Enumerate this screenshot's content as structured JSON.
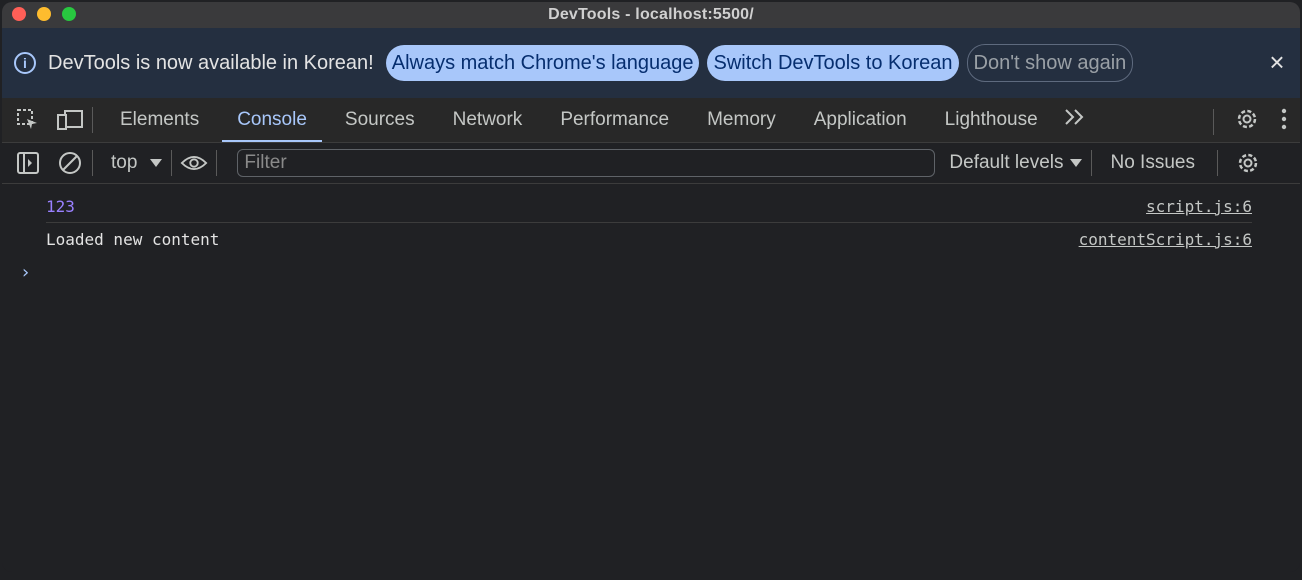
{
  "window": {
    "title": "DevTools - localhost:5500/"
  },
  "infobar": {
    "message": "DevTools is now available in Korean!",
    "buttons": [
      {
        "label": "Always match Chrome's language"
      },
      {
        "label": "Switch DevTools to Korean"
      },
      {
        "label": "Don't show again"
      }
    ],
    "close_icon": "close-icon"
  },
  "tabs": [
    {
      "label": "Elements"
    },
    {
      "label": "Console",
      "active": true
    },
    {
      "label": "Sources"
    },
    {
      "label": "Network"
    },
    {
      "label": "Performance"
    },
    {
      "label": "Memory"
    },
    {
      "label": "Application"
    },
    {
      "label": "Lighthouse"
    }
  ],
  "console_toolbar": {
    "context": "top",
    "filter_placeholder": "Filter",
    "levels": "Default levels",
    "issues": "No Issues"
  },
  "console": {
    "messages": [
      {
        "text": "123",
        "source": "script.js:6"
      },
      {
        "text": "Loaded new content",
        "source": "contentScript.js:6"
      }
    ],
    "prompt": "›"
  },
  "colors": {
    "accent": "#a8c7fa",
    "background": "#202124",
    "number": "#9980ff"
  }
}
